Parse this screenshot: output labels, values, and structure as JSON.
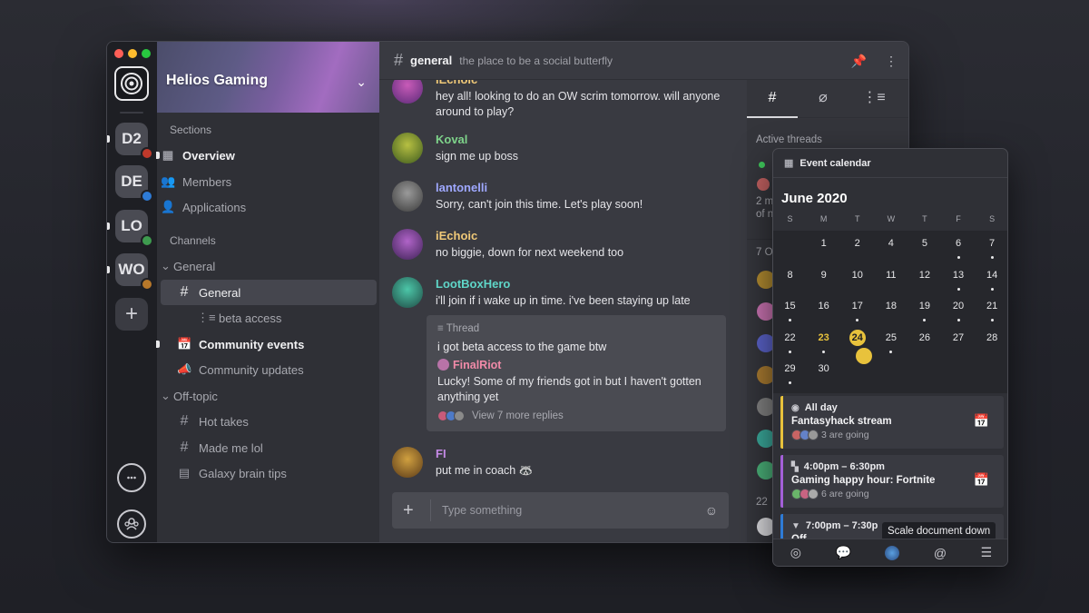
{
  "server": {
    "name": "Helios Gaming",
    "rail_servers": [
      {
        "abbr": "D2",
        "badge_color": "#c0392b",
        "unread": true
      },
      {
        "abbr": "DE",
        "badge_color": "#2e7bd6",
        "unread": false
      },
      {
        "abbr": "LO",
        "badge_color": "#3e9b4f",
        "unread": true
      },
      {
        "abbr": "WO",
        "badge_color": "#b8782a",
        "unread": true
      }
    ]
  },
  "sidebar": {
    "sections_label": "Sections",
    "sections": [
      {
        "label": "Overview",
        "icon": "grid-icon",
        "bold": true,
        "unread": true
      },
      {
        "label": "Members",
        "icon": "members-icon",
        "bold": false
      },
      {
        "label": "Applications",
        "icon": "add-member-icon",
        "bold": false
      }
    ],
    "channels_label": "Channels",
    "groups": [
      {
        "label": "General",
        "channels": [
          {
            "label": "General",
            "icon": "#",
            "active": true
          },
          {
            "label": "beta access",
            "icon": "thread",
            "indent": true
          },
          {
            "label": "Community events",
            "icon": "calendar",
            "bold": true,
            "unread": true
          },
          {
            "label": "Community updates",
            "icon": "megaphone"
          }
        ]
      },
      {
        "label": "Off-topic",
        "channels": [
          {
            "label": "Hot takes",
            "icon": "#"
          },
          {
            "label": "Made me lol",
            "icon": "#"
          },
          {
            "label": "Galaxy brain tips",
            "icon": "board"
          }
        ]
      }
    ]
  },
  "channel": {
    "name": "general",
    "topic": "the place to be a social butterfly"
  },
  "messages": [
    {
      "author": "iEchoic",
      "color": "#f0c978",
      "text": "hey all! looking to do an OW scrim tomorrow. will anyone around to play?"
    },
    {
      "author": "Koval",
      "color": "#7ed38a",
      "text": "sign me up boss"
    },
    {
      "author": "lantonelli",
      "color": "#9fa8ff",
      "text": "Sorry, can't join this time. Let's play soon!"
    },
    {
      "author": "iEchoic",
      "color": "#f0c978",
      "text": "no biggie, down for next weekend too"
    },
    {
      "author": "LootBoxHero",
      "color": "#5fd6c8",
      "text": "i'll join if i wake up in time. i've been staying up late"
    },
    {
      "author": "FI",
      "color": "#c58ae6",
      "text": "put me in coach 🦝"
    }
  ],
  "thread": {
    "label": "Thread",
    "text": "i got beta access to the game btw",
    "reply_author": "FinalRiot",
    "reply_text": "Lucky! Some of my friends got in but I haven't gotten anything yet",
    "more": "View 7 more replies"
  },
  "composer": {
    "placeholder": "Type something"
  },
  "right_panel": {
    "active_threads_label": "Active threads",
    "frag_a": "2 m",
    "frag_b": "of n",
    "frag_c": "7 O",
    "frag_d": "22"
  },
  "calendar": {
    "header": "Event calendar",
    "month": "June 2020",
    "weekdays": [
      "S",
      "M",
      "T",
      "W",
      "T",
      "F",
      "S"
    ],
    "weeks": [
      [
        "",
        "1",
        "2",
        "4",
        "5",
        "6",
        "7"
      ],
      [
        "8",
        "9",
        "10",
        "11",
        "12",
        "13",
        "14"
      ],
      [
        "15",
        "16",
        "17",
        "18",
        "19",
        "20",
        "21"
      ],
      [
        "22",
        "23",
        "24",
        "25",
        "26",
        "27",
        "28"
      ],
      [
        "29",
        "30",
        "",
        "",
        "",
        "",
        ""
      ]
    ],
    "today": "23",
    "selected": "24",
    "events": [
      {
        "when": "All day",
        "title": "Fantasyhack stream",
        "going": "3 are going",
        "color": "#e8c23c"
      },
      {
        "when": "4:00pm – 6:30pm",
        "title": "Gaming happy hour: Fortnite",
        "going": "6 are going",
        "color": "#a35fd8"
      },
      {
        "when": "7:00pm – 7:30p",
        "title": "Off",
        "going": "",
        "color": "#2e7bd6"
      }
    ],
    "tooltip": "Scale document down"
  }
}
